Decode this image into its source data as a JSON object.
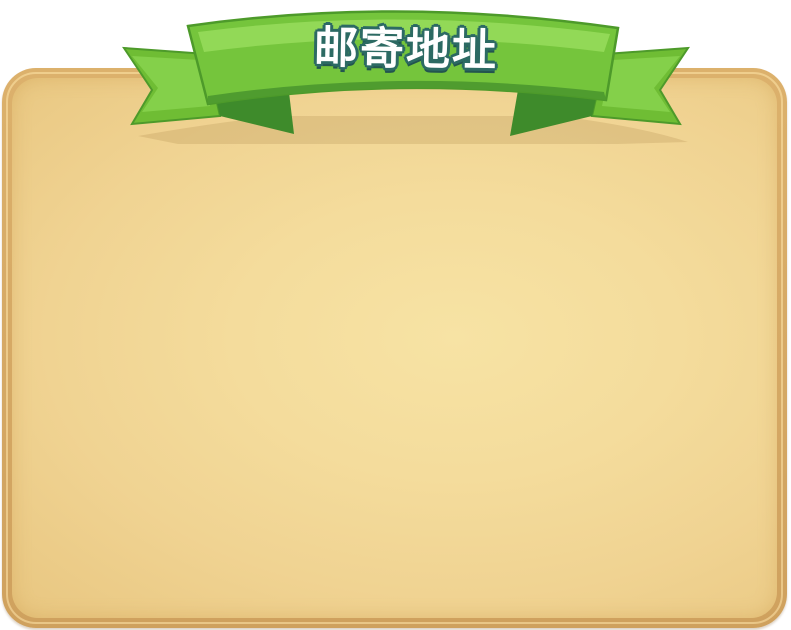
{
  "banner": {
    "title": "邮寄地址"
  },
  "colors": {
    "ribbon_green": "#7dc83f",
    "ribbon_dark": "#3f8f2a",
    "title_outline": "#2c6a63",
    "parchment": "#f4dc9c",
    "frame": "#d6a966"
  },
  "icons": {
    "banner": "green-ribbon-banner"
  }
}
